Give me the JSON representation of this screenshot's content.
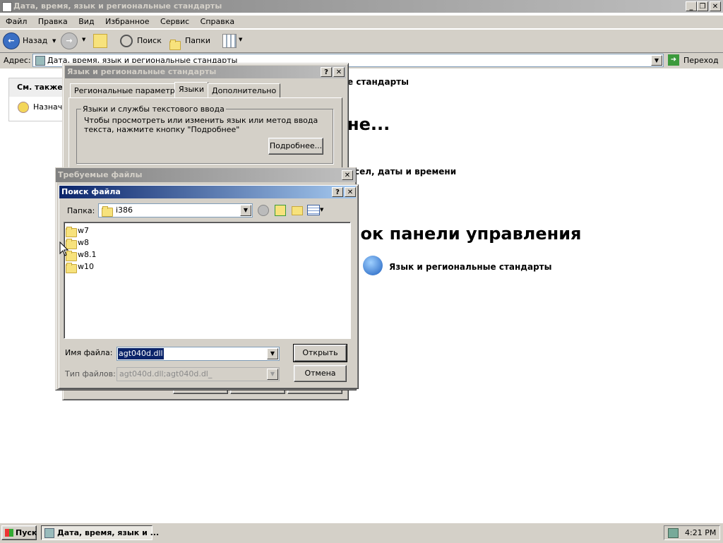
{
  "window": {
    "title": "Дата, время, язык и региональные стандарты"
  },
  "menu": [
    "Файл",
    "Правка",
    "Вид",
    "Избранное",
    "Сервис",
    "Справка"
  ],
  "toolbar": {
    "back": "Назад",
    "search": "Поиск",
    "folders": "Папки"
  },
  "address": {
    "label": "Адрес:",
    "value": "Дата, время, язык и региональные стандарты",
    "go": "Переход"
  },
  "sidebar": {
    "header": "См. также",
    "item": "Назначе"
  },
  "background": {
    "frag1": "е стандарты",
    "frag2": "не...",
    "frag3": "сел, даты и времени",
    "frag4": "чок панели управления",
    "cp_item": "Язык и региональные стандарты"
  },
  "regional_dialog": {
    "title": "Язык и региональные стандарты",
    "tabs": [
      "Региональные параметры",
      "Языки",
      "Дополнительно"
    ],
    "group_title": "Языки и службы текстового ввода",
    "group_text": "Чтобы просмотреть или изменить язык или метод ввода текста, нажмите кнопку \"Подробнее\"",
    "details_button": "Подробнее..."
  },
  "required_files": {
    "title": "Требуемые файлы"
  },
  "file_dialog": {
    "title": "Поиск файла",
    "folder_label": "Папка:",
    "folder_value": "i386",
    "folders": [
      "w7",
      "w8",
      "w8.1",
      "w10"
    ],
    "filename_label": "Имя файла:",
    "filename_value": "agt040d.dll",
    "filetype_label": "Тип файлов:",
    "filetype_value": "agt040d.dll;agt040d.dl_",
    "open_button": "Открыть",
    "cancel_button": "Отмена"
  },
  "taskbar": {
    "start": "Пуск",
    "task": "Дата, время, язык и ...",
    "clock": "4:21 PM"
  }
}
